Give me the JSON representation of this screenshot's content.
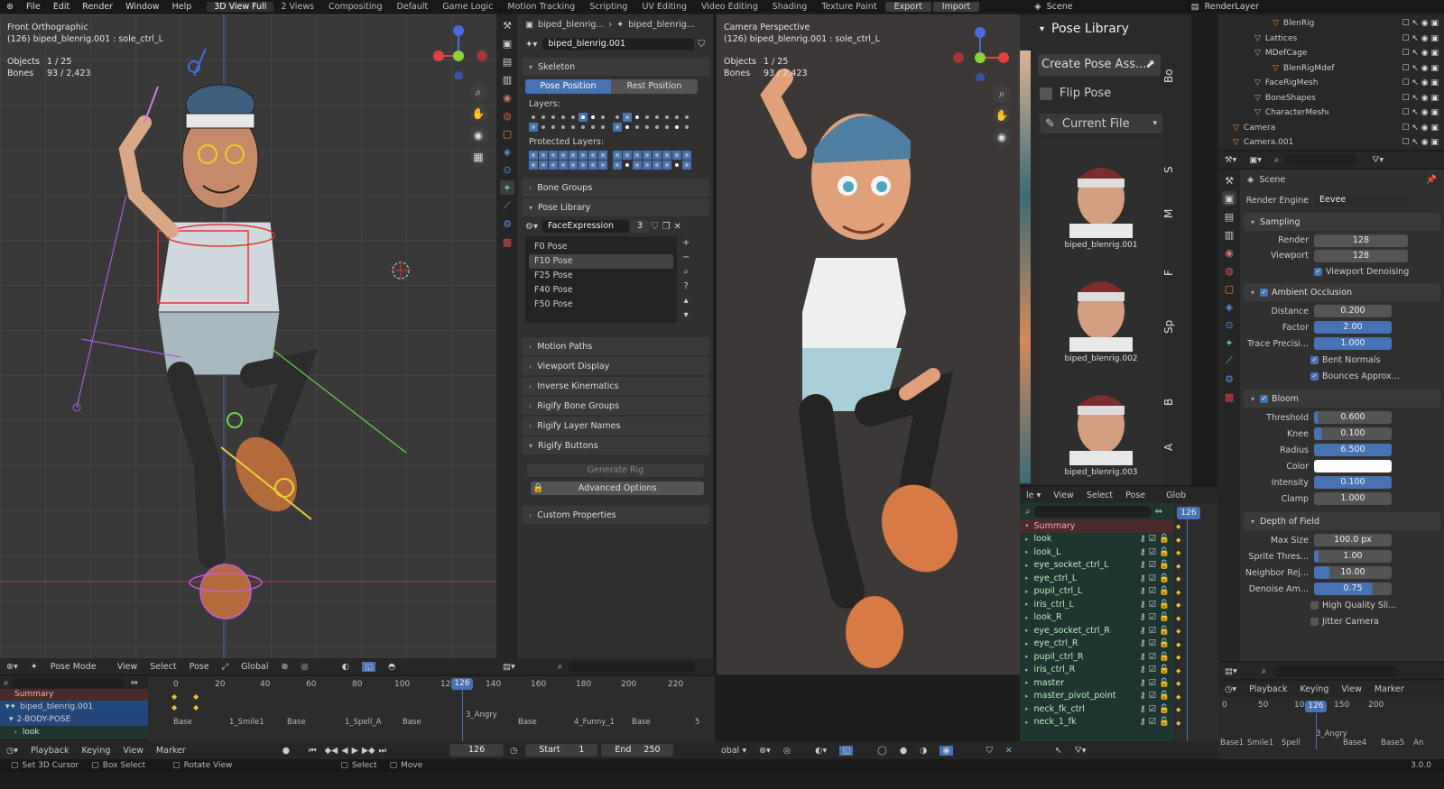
{
  "menu": [
    "File",
    "Edit",
    "Render",
    "Window",
    "Help"
  ],
  "workspaces": [
    "3D View Full",
    "2 Views",
    "Compositing",
    "Default",
    "Game Logic",
    "Motion Tracking",
    "Scripting",
    "UV Editing",
    "Video Editing",
    "Shading",
    "Texture Paint"
  ],
  "top_buttons": {
    "export": "Export",
    "import": "Import"
  },
  "scene_name": "Scene",
  "render_layer": "RenderLayer",
  "viewport_left": {
    "view_name": "Front Orthographic",
    "object_info": "(126) biped_blenrig.001 : sole_ctrl_L",
    "objects_label": "Objects",
    "objects_value": "1 / 25",
    "bones_label": "Bones",
    "bones_value": "93 / 2,423",
    "header": {
      "mode": "Pose Mode",
      "view": "View",
      "select": "Select",
      "pose": "Pose",
      "orientation": "Global"
    }
  },
  "viewport_right": {
    "view_name": "Camera Perspective",
    "object_info": "(126) biped_blenrig.001 : sole_ctrl_L",
    "objects_label": "Objects",
    "objects_value": "1 / 25",
    "bones_label": "Bones",
    "bones_value": "93 / 2,423"
  },
  "bone_props": {
    "breadcrumb_a": "biped_blenrig...",
    "breadcrumb_b": "biped_blenrig...",
    "armature_name": "biped_blenrig.001",
    "skeleton": "Skeleton",
    "pose_position": "Pose Position",
    "rest_position": "Rest Position",
    "layers": "Layers:",
    "protected_layers": "Protected Layers:",
    "bone_groups": "Bone Groups",
    "pose_library": "Pose Library",
    "library_name": "FaceExpression",
    "library_users": "3",
    "poses": [
      "F0 Pose",
      "F10 Pose",
      "F25 Pose",
      "F40 Pose",
      "F50 Pose"
    ],
    "sections": [
      "Motion Paths",
      "Viewport Display",
      "Inverse Kinematics",
      "Rigify Bone Groups",
      "Rigify Layer Names",
      "Rigify Buttons"
    ],
    "generate_rig": "Generate Rig",
    "advanced_options": "Advanced Options",
    "custom_properties": "Custom Properties"
  },
  "pose_library_panel": {
    "title": "Pose Library",
    "create_pose": "Create Pose Ass...",
    "flip_pose": "Flip Pose",
    "source": "Current File",
    "assets": [
      "biped_blenrig.001",
      "biped_blenrig.002",
      "biped_blenrig.003"
    ],
    "side_tabs": [
      "Bo",
      "S",
      "M",
      "F",
      "Sp",
      "B",
      "A"
    ]
  },
  "outliner": {
    "items": [
      "BlenRig",
      "Lattices",
      "MDefCage",
      "BlenRigMdef",
      "FaceRigMesh",
      "BoneShapes",
      "CharacterMeshes",
      "Camera",
      "Camera.001"
    ]
  },
  "render_props": {
    "scene": "Scene",
    "render_engine_label": "Render Engine",
    "render_engine": "Eevee",
    "sampling": "Sampling",
    "render_label": "Render",
    "render_value": "128",
    "viewport_label": "Viewport",
    "viewport_value": "128",
    "viewport_denoising": "Viewport Denoising",
    "ao": "Ambient Occlusion",
    "distance_label": "Distance",
    "distance": "0.200",
    "factor_label": "Factor",
    "factor": "2.00",
    "trace_label": "Trace Precisi...",
    "trace": "1.000",
    "bent_normals": "Bent Normals",
    "bounces": "Bounces Approx...",
    "bloom": "Bloom",
    "threshold_label": "Threshold",
    "threshold": "0.600",
    "knee_label": "Knee",
    "knee": "0.100",
    "radius_label": "Radius",
    "radius": "6.500",
    "color_label": "Color",
    "intensity_label": "Intensity",
    "intensity": "0.100",
    "clamp_label": "Clamp",
    "clamp": "1.000",
    "dof": "Depth of Field",
    "maxsize_label": "Max Size",
    "maxsize": "100.0 px",
    "sprite_label": "Sprite Thres...",
    "sprite": "1.00",
    "neighbor_label": "Neighbor Rej...",
    "neighbor": "10.00",
    "denoise_label": "Denoise Am...",
    "denoise": "0.75",
    "hq_slider": "High Quality Sli...",
    "jitter": "Jitter Camera"
  },
  "channels": {
    "header": {
      "view": "View",
      "select": "Select",
      "pose": "Pose",
      "global": "Glob"
    },
    "summary": "Summary",
    "items": [
      "look",
      "look_L",
      "eye_socket_ctrl_L",
      "eye_ctrl_L",
      "pupil_ctrl_L",
      "iris_ctrl_L",
      "look_R",
      "eye_socket_ctrl_R",
      "eye_ctrl_R",
      "pupil_ctrl_R",
      "iris_ctrl_R",
      "master",
      "master_pivot_point",
      "neck_fk_ctrl",
      "neck_1_fk"
    ],
    "frame": "126"
  },
  "timeline_left": {
    "summary": "Summary",
    "rig": "biped_blenrig.001",
    "action": "2-BODY-POSE",
    "channel": "look",
    "ticks": [
      "0",
      "20",
      "40",
      "60",
      "80",
      "100",
      "12",
      "140",
      "160",
      "180",
      "200",
      "220"
    ],
    "current_frame": "126",
    "markers": [
      "Base",
      "1_Smile1",
      "Base",
      "1_Spell_A",
      "Base",
      "3_Angry",
      "Base",
      "4_Funny_1",
      "Base",
      "5"
    ],
    "controls": {
      "playback": "Playback",
      "keying": "Keying",
      "view": "View",
      "marker": "Marker"
    },
    "frame_field": "126",
    "start_label": "Start",
    "start": "1",
    "end_label": "End",
    "end": "250"
  },
  "timeline_right": {
    "controls": {
      "playback": "Playback",
      "keying": "Keying",
      "view": "View",
      "marker": "Marker"
    },
    "ticks": [
      "0",
      "50",
      "100",
      "150",
      "200"
    ],
    "current_frame": "126",
    "markers": [
      "Base1",
      "Smile1",
      "Spell",
      "Base4",
      "Base5",
      "An"
    ],
    "marker_angry": "3_Angry"
  },
  "status_bar": {
    "cursor": "Set 3D Cursor",
    "box": "Box Select",
    "rotate": "Rotate View",
    "select": "Select",
    "move": "Move",
    "version": "3.0.0"
  },
  "colors": {
    "accent": "#4772b3",
    "channel_bg": "#1f3a32",
    "channel_text": "#b8f0c0"
  }
}
